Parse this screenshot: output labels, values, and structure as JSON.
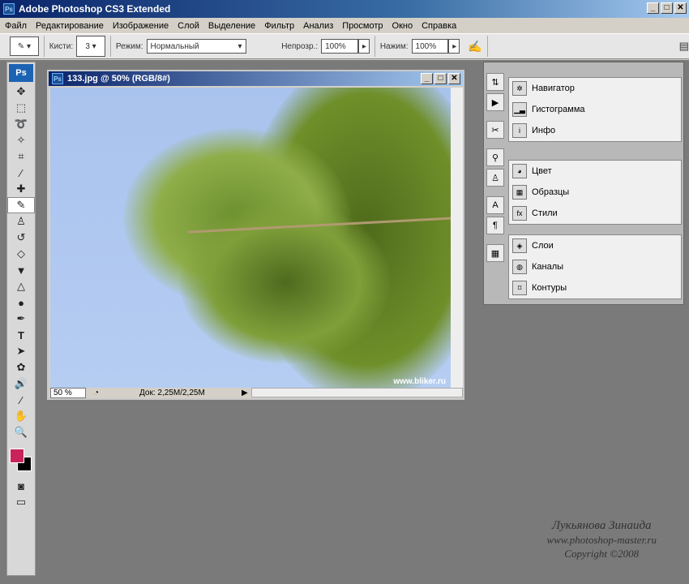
{
  "app": {
    "title": "Adobe Photoshop CS3 Extended",
    "icon": "Ps"
  },
  "menu": [
    "Файл",
    "Редактирование",
    "Изображение",
    "Слой",
    "Выделение",
    "Фильтр",
    "Анализ",
    "Просмотр",
    "Окно",
    "Справка"
  ],
  "options": {
    "brushes_label": "Кисти:",
    "brush_size": "3",
    "mode_label": "Режим:",
    "mode_value": "Нормальный",
    "opacity_label": "Непрозр.:",
    "opacity_value": "100%",
    "flow_label": "Нажим:",
    "flow_value": "100%"
  },
  "document": {
    "title": "133.jpg @ 50% (RGB/8#)",
    "zoom": "50 %",
    "doc_info": "Док: 2,25M/2,25M",
    "image_watermark": "www.bliker.ru"
  },
  "colors": {
    "foreground": "#c8235a",
    "background": "#000000"
  },
  "panels": [
    {
      "items": [
        "Навигатор",
        "Гистограмма",
        "Инфо"
      ]
    },
    {
      "items": [
        "Цвет",
        "Образцы",
        "Стили"
      ]
    },
    {
      "items": [
        "Слои",
        "Каналы",
        "Контуры"
      ]
    }
  ],
  "watermark": {
    "author": "Лукьянова Зинаида",
    "site": "www.photoshop-master.ru",
    "copyright": "Copyright ©2008"
  }
}
